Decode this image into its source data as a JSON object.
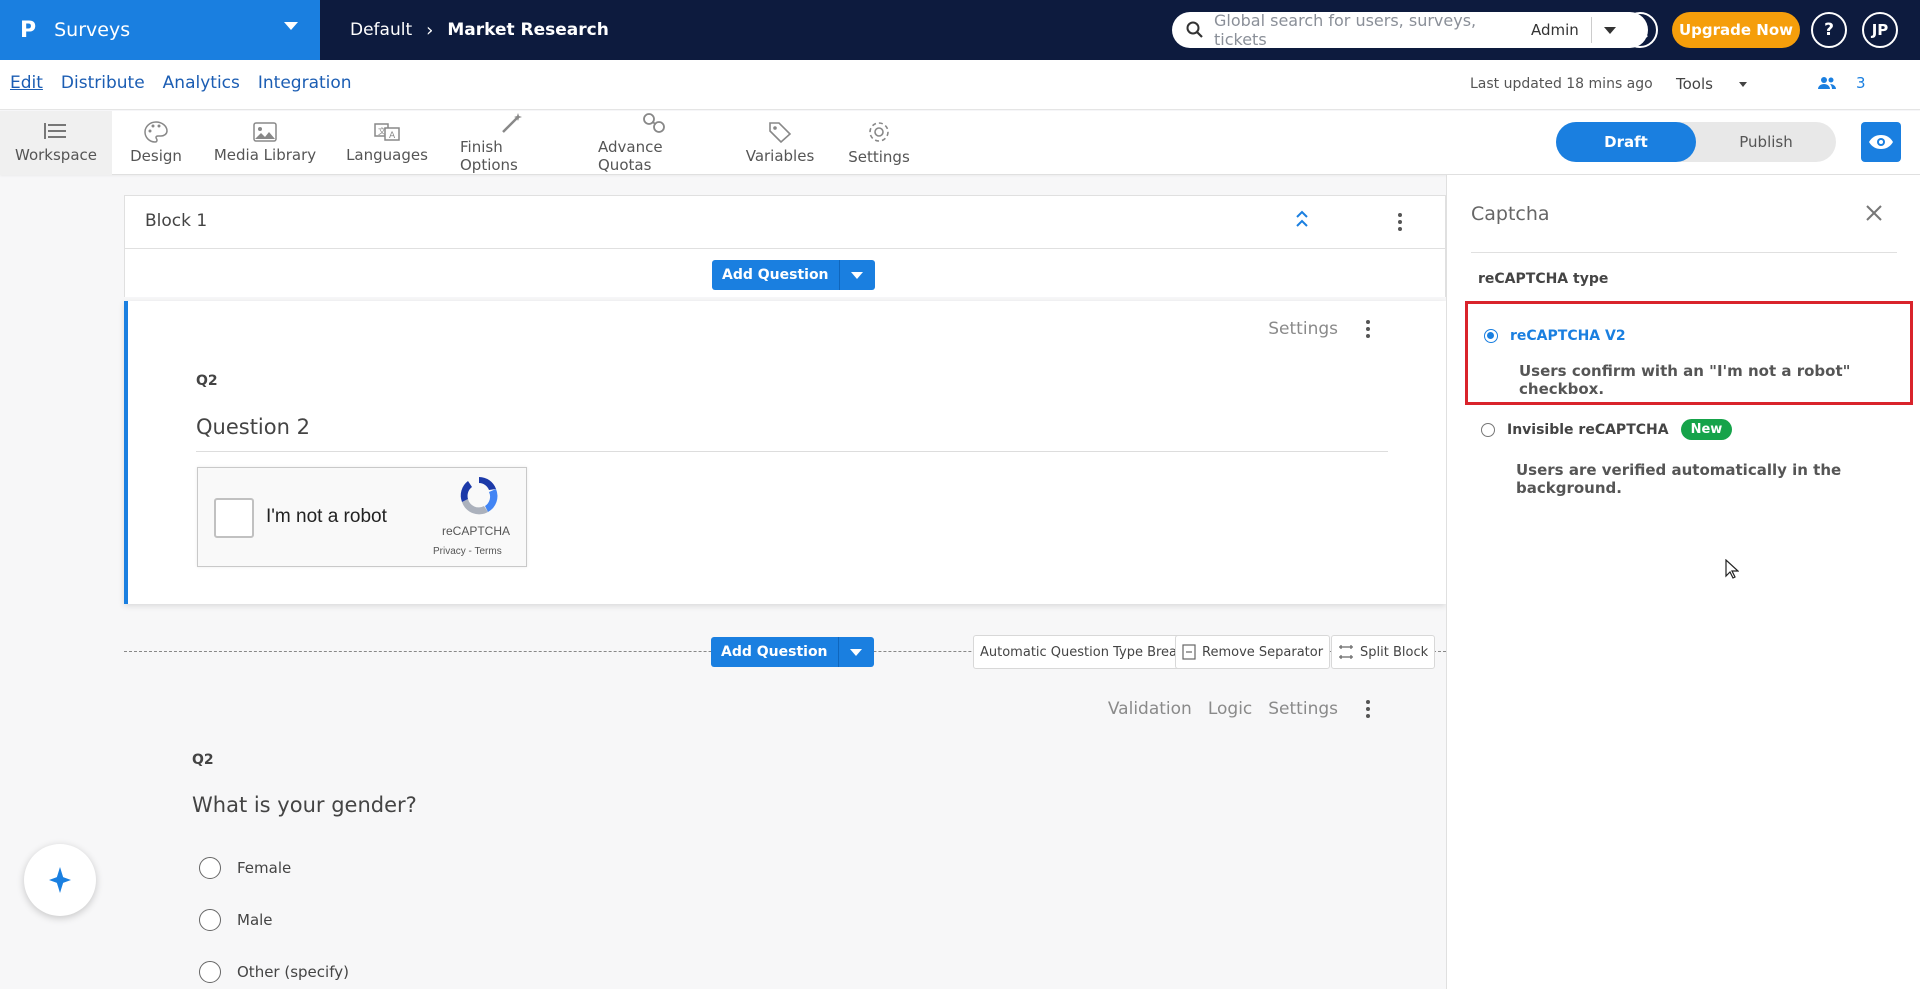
{
  "app": {
    "logo": "P",
    "name": "Surveys"
  },
  "breadcrumb": {
    "parent": "Default",
    "current": "Market Research"
  },
  "search": {
    "placeholder": "Global search for users, surveys, tickets",
    "role": "Admin"
  },
  "header": {
    "upgrade_label": "Upgrade Now",
    "help_label": "?",
    "avatar_initials": "JP"
  },
  "nav": {
    "links": [
      "Edit",
      "Distribute",
      "Analytics",
      "Integration"
    ],
    "last_updated": "Last updated 18 mins ago",
    "tools_label": "Tools",
    "collaborators_count": "3"
  },
  "toolbar": {
    "items": [
      "Workspace",
      "Design",
      "Media Library",
      "Languages",
      "Finish Options",
      "Advance Quotas",
      "Variables",
      "Settings"
    ],
    "draft_label": "Draft",
    "publish_label": "Publish"
  },
  "block": {
    "title": "Block 1",
    "add_question_label": "Add Question"
  },
  "question1": {
    "actions": [
      "Settings"
    ],
    "number": "Q2",
    "text": "Question 2",
    "recaptcha": {
      "checkbox_label": "I'm not a robot",
      "brand": "reCAPTCHA",
      "links": "Privacy - Terms"
    }
  },
  "separator": {
    "add_question_label": "Add Question",
    "buttons": [
      "Automatic Question Type Break",
      "Remove Separator",
      "Split Block"
    ]
  },
  "question2": {
    "actions": [
      "Validation",
      "Logic",
      "Settings"
    ],
    "number": "Q2",
    "text": "What is your gender?",
    "options": [
      "Female",
      "Male",
      "Other (specify)"
    ]
  },
  "panel": {
    "title": "Captcha",
    "subtitle": "reCAPTCHA type",
    "options": [
      {
        "label": "reCAPTCHA V2",
        "desc": "Users confirm with an \"I'm not a robot\" checkbox.",
        "selected": true
      },
      {
        "label": "Invisible reCAPTCHA",
        "badge": "New",
        "desc": "Users are verified automatically in the background.",
        "selected": false
      }
    ]
  },
  "colors": {
    "accent": "#1a7fe0",
    "topbar": "#0d1b3e",
    "upgrade": "#f59e0b",
    "highlight": "#d9232b",
    "new_badge": "#16a34a"
  }
}
